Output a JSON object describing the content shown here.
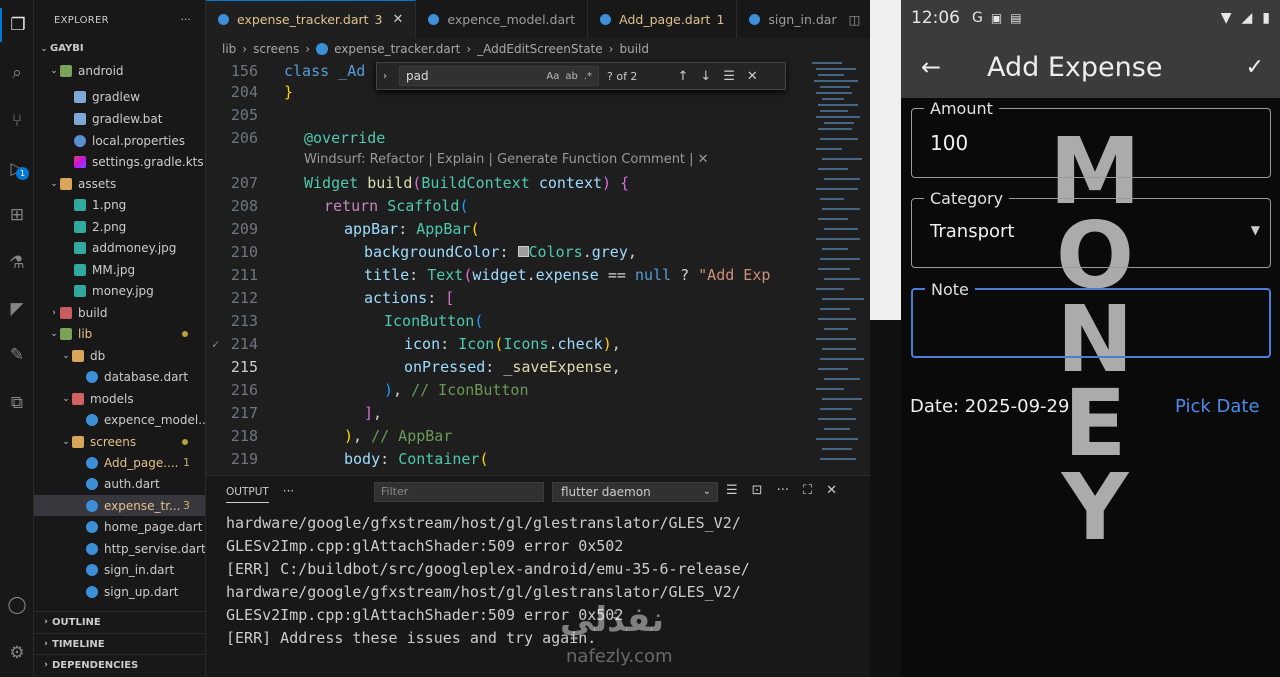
{
  "sidebar": {
    "title": "EXPLORER",
    "project": "GAYBI",
    "items": [
      {
        "label": "android"
      },
      {
        "label": "gradlew"
      },
      {
        "label": "gradlew.bat"
      },
      {
        "label": "local.properties"
      },
      {
        "label": "settings.gradle.kts"
      },
      {
        "label": "assets"
      },
      {
        "label": "1.png"
      },
      {
        "label": "2.png"
      },
      {
        "label": "addmoney.jpg"
      },
      {
        "label": "MM.jpg"
      },
      {
        "label": "money.jpg"
      },
      {
        "label": "build"
      },
      {
        "label": "lib"
      },
      {
        "label": "db"
      },
      {
        "label": "database.dart"
      },
      {
        "label": "models"
      },
      {
        "label": "expence_model...."
      },
      {
        "label": "screens"
      },
      {
        "label": "Add_page....",
        "badge": "1"
      },
      {
        "label": "auth.dart"
      },
      {
        "label": "expense_tr...",
        "badge": "3"
      },
      {
        "label": "home_page.dart"
      },
      {
        "label": "http_servise.dart"
      },
      {
        "label": "sign_in.dart"
      },
      {
        "label": "sign_up.dart"
      }
    ],
    "sections": [
      "OUTLINE",
      "TIMELINE",
      "DEPENDENCIES"
    ]
  },
  "tabs": [
    {
      "label": "expense_tracker.dart",
      "count": "3"
    },
    {
      "label": "expence_model.dart"
    },
    {
      "label": "Add_page.dart",
      "count": "1"
    },
    {
      "label": "sign_in.dar"
    }
  ],
  "breadcrumb": [
    "lib",
    "screens",
    "expense_tracker.dart",
    "_AddEditScreenState",
    "build"
  ],
  "find": {
    "query": "pad",
    "opt_case": "Aa",
    "opt_word": "ab",
    "opt_regex": ".*",
    "result": "? of 2"
  },
  "code": {
    "sticky_line": "156",
    "sticky_text": "class _Ad",
    "line_numbers": [
      "204",
      "205",
      "206",
      "207",
      "208",
      "209",
      "210",
      "211",
      "212",
      "213",
      "214",
      "215",
      "216",
      "217",
      "218",
      "219"
    ],
    "lens": "Windsurf: Refactor | Explain | Generate Function Comment | ✕"
  },
  "output": {
    "tab": "OUTPUT",
    "filter_placeholder": "Filter",
    "channel": "flutter daemon",
    "lines": [
      "hardware/google/gfxstream/host/gl/glestranslator/GLES_V2/",
      "GLESv2Imp.cpp:glAttachShader:509 error 0x502",
      "[ERR] C:/buildbot/src/googleplex-android/emu-35-6-release/",
      "hardware/google/gfxstream/host/gl/glestranslator/GLES_V2/",
      "GLESv2Imp.cpp:glAttachShader:509 error 0x502",
      "[ERR] Address these issues and try again."
    ]
  },
  "phone": {
    "time": "12:06",
    "title": "Add Expense",
    "amount_label": "Amount",
    "amount_value": "100",
    "category_label": "Category",
    "category_value": "Transport",
    "note_label": "Note",
    "date_text": "Date: 2025-09-29",
    "pick_date": "Pick Date",
    "background_word": "MONEY"
  },
  "watermark": {
    "arabic": "نفذلي",
    "site": "nafezly.com"
  }
}
